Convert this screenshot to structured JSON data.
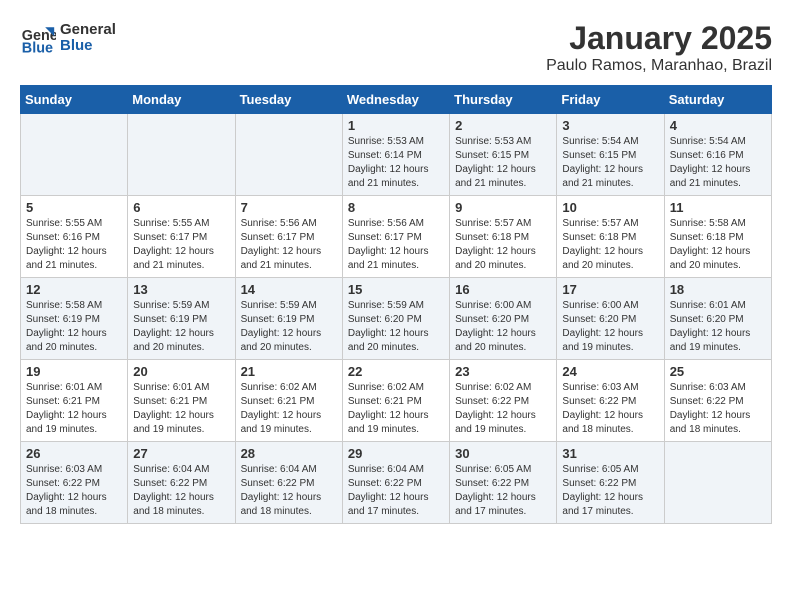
{
  "header": {
    "logo_line1": "General",
    "logo_line2": "Blue",
    "month_title": "January 2025",
    "subtitle": "Paulo Ramos, Maranhao, Brazil"
  },
  "weekdays": [
    "Sunday",
    "Monday",
    "Tuesday",
    "Wednesday",
    "Thursday",
    "Friday",
    "Saturday"
  ],
  "weeks": [
    [
      {
        "day": "",
        "info": ""
      },
      {
        "day": "",
        "info": ""
      },
      {
        "day": "",
        "info": ""
      },
      {
        "day": "1",
        "info": "Sunrise: 5:53 AM\nSunset: 6:14 PM\nDaylight: 12 hours\nand 21 minutes."
      },
      {
        "day": "2",
        "info": "Sunrise: 5:53 AM\nSunset: 6:15 PM\nDaylight: 12 hours\nand 21 minutes."
      },
      {
        "day": "3",
        "info": "Sunrise: 5:54 AM\nSunset: 6:15 PM\nDaylight: 12 hours\nand 21 minutes."
      },
      {
        "day": "4",
        "info": "Sunrise: 5:54 AM\nSunset: 6:16 PM\nDaylight: 12 hours\nand 21 minutes."
      }
    ],
    [
      {
        "day": "5",
        "info": "Sunrise: 5:55 AM\nSunset: 6:16 PM\nDaylight: 12 hours\nand 21 minutes."
      },
      {
        "day": "6",
        "info": "Sunrise: 5:55 AM\nSunset: 6:17 PM\nDaylight: 12 hours\nand 21 minutes."
      },
      {
        "day": "7",
        "info": "Sunrise: 5:56 AM\nSunset: 6:17 PM\nDaylight: 12 hours\nand 21 minutes."
      },
      {
        "day": "8",
        "info": "Sunrise: 5:56 AM\nSunset: 6:17 PM\nDaylight: 12 hours\nand 21 minutes."
      },
      {
        "day": "9",
        "info": "Sunrise: 5:57 AM\nSunset: 6:18 PM\nDaylight: 12 hours\nand 20 minutes."
      },
      {
        "day": "10",
        "info": "Sunrise: 5:57 AM\nSunset: 6:18 PM\nDaylight: 12 hours\nand 20 minutes."
      },
      {
        "day": "11",
        "info": "Sunrise: 5:58 AM\nSunset: 6:18 PM\nDaylight: 12 hours\nand 20 minutes."
      }
    ],
    [
      {
        "day": "12",
        "info": "Sunrise: 5:58 AM\nSunset: 6:19 PM\nDaylight: 12 hours\nand 20 minutes."
      },
      {
        "day": "13",
        "info": "Sunrise: 5:59 AM\nSunset: 6:19 PM\nDaylight: 12 hours\nand 20 minutes."
      },
      {
        "day": "14",
        "info": "Sunrise: 5:59 AM\nSunset: 6:19 PM\nDaylight: 12 hours\nand 20 minutes."
      },
      {
        "day": "15",
        "info": "Sunrise: 5:59 AM\nSunset: 6:20 PM\nDaylight: 12 hours\nand 20 minutes."
      },
      {
        "day": "16",
        "info": "Sunrise: 6:00 AM\nSunset: 6:20 PM\nDaylight: 12 hours\nand 20 minutes."
      },
      {
        "day": "17",
        "info": "Sunrise: 6:00 AM\nSunset: 6:20 PM\nDaylight: 12 hours\nand 19 minutes."
      },
      {
        "day": "18",
        "info": "Sunrise: 6:01 AM\nSunset: 6:20 PM\nDaylight: 12 hours\nand 19 minutes."
      }
    ],
    [
      {
        "day": "19",
        "info": "Sunrise: 6:01 AM\nSunset: 6:21 PM\nDaylight: 12 hours\nand 19 minutes."
      },
      {
        "day": "20",
        "info": "Sunrise: 6:01 AM\nSunset: 6:21 PM\nDaylight: 12 hours\nand 19 minutes."
      },
      {
        "day": "21",
        "info": "Sunrise: 6:02 AM\nSunset: 6:21 PM\nDaylight: 12 hours\nand 19 minutes."
      },
      {
        "day": "22",
        "info": "Sunrise: 6:02 AM\nSunset: 6:21 PM\nDaylight: 12 hours\nand 19 minutes."
      },
      {
        "day": "23",
        "info": "Sunrise: 6:02 AM\nSunset: 6:22 PM\nDaylight: 12 hours\nand 19 minutes."
      },
      {
        "day": "24",
        "info": "Sunrise: 6:03 AM\nSunset: 6:22 PM\nDaylight: 12 hours\nand 18 minutes."
      },
      {
        "day": "25",
        "info": "Sunrise: 6:03 AM\nSunset: 6:22 PM\nDaylight: 12 hours\nand 18 minutes."
      }
    ],
    [
      {
        "day": "26",
        "info": "Sunrise: 6:03 AM\nSunset: 6:22 PM\nDaylight: 12 hours\nand 18 minutes."
      },
      {
        "day": "27",
        "info": "Sunrise: 6:04 AM\nSunset: 6:22 PM\nDaylight: 12 hours\nand 18 minutes."
      },
      {
        "day": "28",
        "info": "Sunrise: 6:04 AM\nSunset: 6:22 PM\nDaylight: 12 hours\nand 18 minutes."
      },
      {
        "day": "29",
        "info": "Sunrise: 6:04 AM\nSunset: 6:22 PM\nDaylight: 12 hours\nand 17 minutes."
      },
      {
        "day": "30",
        "info": "Sunrise: 6:05 AM\nSunset: 6:22 PM\nDaylight: 12 hours\nand 17 minutes."
      },
      {
        "day": "31",
        "info": "Sunrise: 6:05 AM\nSunset: 6:22 PM\nDaylight: 12 hours\nand 17 minutes."
      },
      {
        "day": "",
        "info": ""
      }
    ]
  ]
}
